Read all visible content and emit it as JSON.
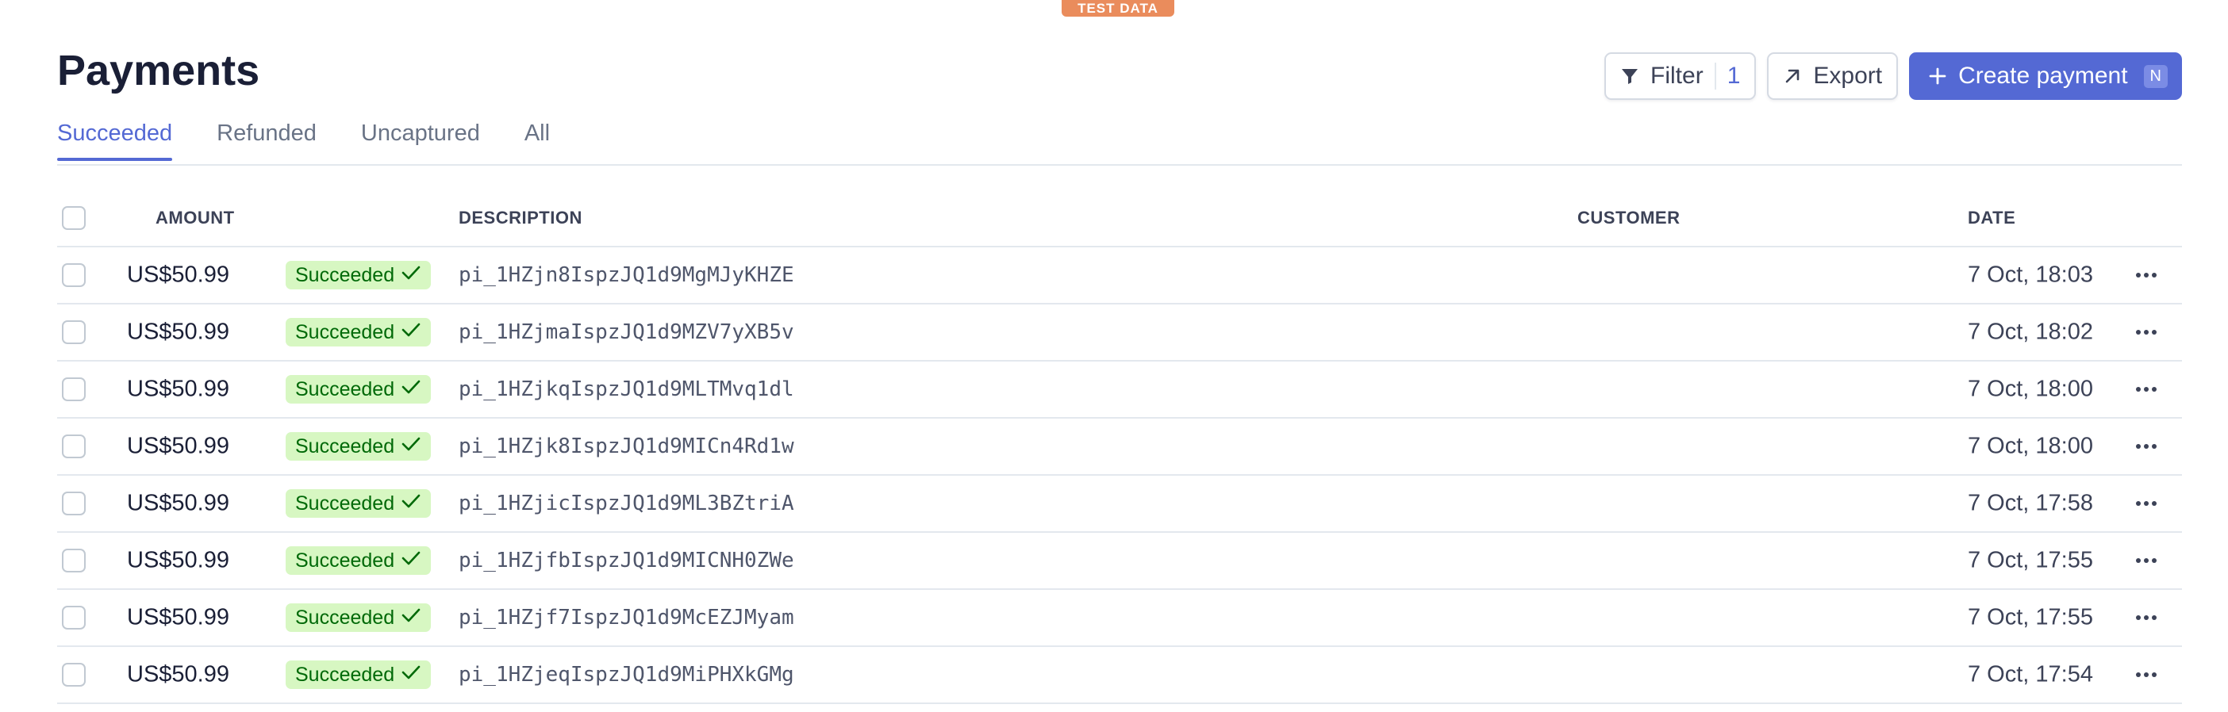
{
  "banner": {
    "label": "TEST DATA"
  },
  "page": {
    "title": "Payments"
  },
  "toolbar": {
    "filter_label": "Filter",
    "filter_count": "1",
    "export_label": "Export",
    "create_label": "Create payment",
    "create_shortcut": "N",
    "primary_color": "#5469d4"
  },
  "tabs": [
    {
      "label": "Succeeded",
      "active": true
    },
    {
      "label": "Refunded",
      "active": false
    },
    {
      "label": "Uncaptured",
      "active": false
    },
    {
      "label": "All",
      "active": false
    }
  ],
  "table": {
    "columns": {
      "amount": "AMOUNT",
      "description": "DESCRIPTION",
      "customer": "CUSTOMER",
      "date": "DATE"
    },
    "rows": [
      {
        "amount": "US$50.99",
        "status": "Succeeded",
        "description": "pi_1HZjn8IspzJQ1d9MgMJyKHZE",
        "customer": "",
        "date": "7 Oct, 18:03"
      },
      {
        "amount": "US$50.99",
        "status": "Succeeded",
        "description": "pi_1HZjmaIspzJQ1d9MZV7yXB5v",
        "customer": "",
        "date": "7 Oct, 18:02"
      },
      {
        "amount": "US$50.99",
        "status": "Succeeded",
        "description": "pi_1HZjkqIspzJQ1d9MLTMvq1dl",
        "customer": "",
        "date": "7 Oct, 18:00"
      },
      {
        "amount": "US$50.99",
        "status": "Succeeded",
        "description": "pi_1HZjk8IspzJQ1d9MICn4Rd1w",
        "customer": "",
        "date": "7 Oct, 18:00"
      },
      {
        "amount": "US$50.99",
        "status": "Succeeded",
        "description": "pi_1HZjicIspzJQ1d9ML3BZtriA",
        "customer": "",
        "date": "7 Oct, 17:58"
      },
      {
        "amount": "US$50.99",
        "status": "Succeeded",
        "description": "pi_1HZjfbIspzJQ1d9MICNH0ZWe",
        "customer": "",
        "date": "7 Oct, 17:55"
      },
      {
        "amount": "US$50.99",
        "status": "Succeeded",
        "description": "pi_1HZjf7IspzJQ1d9McEZJMyam",
        "customer": "",
        "date": "7 Oct, 17:55"
      },
      {
        "amount": "US$50.99",
        "status": "Succeeded",
        "description": "pi_1HZjeqIspzJQ1d9MiPHXkGMg",
        "customer": "",
        "date": "7 Oct, 17:54"
      }
    ]
  },
  "icons": {
    "filter": "filter-icon",
    "export": "arrow-up-right-icon",
    "create": "plus-icon",
    "status": "check-icon",
    "row_menu": "more-horizontal-icon"
  },
  "colors": {
    "badge_bg": "#d7f7c2",
    "badge_text": "#006908",
    "test_badge": "#ea8c5c"
  }
}
